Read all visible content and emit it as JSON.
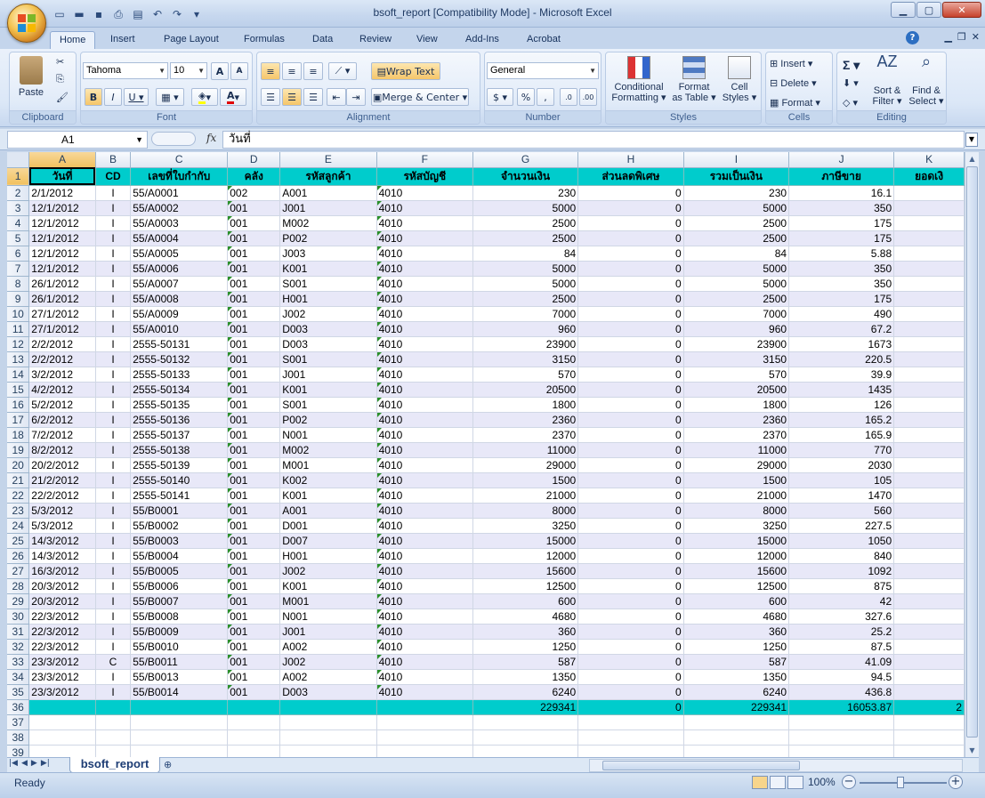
{
  "window": {
    "title": "bsoft_report  [Compatibility Mode] - Microsoft Excel"
  },
  "ribbon_tabs": [
    "Home",
    "Insert",
    "Page Layout",
    "Formulas",
    "Data",
    "Review",
    "View",
    "Add-Ins",
    "Acrobat"
  ],
  "ribbon": {
    "clipboard": {
      "label": "Clipboard",
      "paste": "Paste"
    },
    "font": {
      "label": "Font",
      "name": "Tahoma",
      "size": "10"
    },
    "alignment": {
      "label": "Alignment",
      "wrap_text": "Wrap Text",
      "merge_center": "Merge & Center"
    },
    "number": {
      "label": "Number",
      "format": "General"
    },
    "styles": {
      "label": "Styles",
      "conditional_1": "Conditional",
      "conditional_2": "Formatting",
      "format_table_1": "Format",
      "format_table_2": "as Table",
      "cell_styles_1": "Cell",
      "cell_styles_2": "Styles"
    },
    "cells": {
      "label": "Cells",
      "insert": "Insert",
      "delete": "Delete",
      "format": "Format"
    },
    "editing": {
      "label": "Editing",
      "sort_1": "Sort &",
      "sort_2": "Filter",
      "find_1": "Find &",
      "find_2": "Select"
    }
  },
  "formula_bar": {
    "name_box": "A1",
    "fx": "fx",
    "content": "วันที่"
  },
  "columns": [
    "A",
    "B",
    "C",
    "D",
    "E",
    "F",
    "G",
    "H",
    "I",
    "J",
    "K"
  ],
  "headers": [
    "วันที่",
    "CD",
    "เลขที่ใบกำกับ",
    "คลัง",
    "รหัสลูกค้า",
    "รหัสบัญชี",
    "จำนวนเงิน",
    "ส่วนลดพิเศษ",
    "รวมเป็นเงิน",
    "ภาษีขาย",
    "ยอดเงิ"
  ],
  "rows": [
    [
      "2/1/2012",
      "I",
      "55/A0001",
      "002",
      "A001",
      "4010",
      "230",
      "0",
      "230",
      "16.1"
    ],
    [
      "12/1/2012",
      "I",
      "55/A0002",
      "001",
      "J001",
      "4010",
      "5000",
      "0",
      "5000",
      "350"
    ],
    [
      "12/1/2012",
      "I",
      "55/A0003",
      "001",
      "M002",
      "4010",
      "2500",
      "0",
      "2500",
      "175"
    ],
    [
      "12/1/2012",
      "I",
      "55/A0004",
      "001",
      "P002",
      "4010",
      "2500",
      "0",
      "2500",
      "175"
    ],
    [
      "12/1/2012",
      "I",
      "55/A0005",
      "001",
      "J003",
      "4010",
      "84",
      "0",
      "84",
      "5.88"
    ],
    [
      "12/1/2012",
      "I",
      "55/A0006",
      "001",
      "K001",
      "4010",
      "5000",
      "0",
      "5000",
      "350"
    ],
    [
      "26/1/2012",
      "I",
      "55/A0007",
      "001",
      "S001",
      "4010",
      "5000",
      "0",
      "5000",
      "350"
    ],
    [
      "26/1/2012",
      "I",
      "55/A0008",
      "001",
      "H001",
      "4010",
      "2500",
      "0",
      "2500",
      "175"
    ],
    [
      "27/1/2012",
      "I",
      "55/A0009",
      "001",
      "J002",
      "4010",
      "7000",
      "0",
      "7000",
      "490"
    ],
    [
      "27/1/2012",
      "I",
      "55/A0010",
      "001",
      "D003",
      "4010",
      "960",
      "0",
      "960",
      "67.2"
    ],
    [
      "2/2/2012",
      "I",
      "2555-50131",
      "001",
      "D003",
      "4010",
      "23900",
      "0",
      "23900",
      "1673"
    ],
    [
      "2/2/2012",
      "I",
      "2555-50132",
      "001",
      "S001",
      "4010",
      "3150",
      "0",
      "3150",
      "220.5"
    ],
    [
      "3/2/2012",
      "I",
      "2555-50133",
      "001",
      "J001",
      "4010",
      "570",
      "0",
      "570",
      "39.9"
    ],
    [
      "4/2/2012",
      "I",
      "2555-50134",
      "001",
      "K001",
      "4010",
      "20500",
      "0",
      "20500",
      "1435"
    ],
    [
      "5/2/2012",
      "I",
      "2555-50135",
      "001",
      "S001",
      "4010",
      "1800",
      "0",
      "1800",
      "126"
    ],
    [
      "6/2/2012",
      "I",
      "2555-50136",
      "001",
      "P002",
      "4010",
      "2360",
      "0",
      "2360",
      "165.2"
    ],
    [
      "7/2/2012",
      "I",
      "2555-50137",
      "001",
      "N001",
      "4010",
      "2370",
      "0",
      "2370",
      "165.9"
    ],
    [
      "8/2/2012",
      "I",
      "2555-50138",
      "001",
      "M002",
      "4010",
      "11000",
      "0",
      "11000",
      "770"
    ],
    [
      "20/2/2012",
      "I",
      "2555-50139",
      "001",
      "M001",
      "4010",
      "29000",
      "0",
      "29000",
      "2030"
    ],
    [
      "21/2/2012",
      "I",
      "2555-50140",
      "001",
      "K002",
      "4010",
      "1500",
      "0",
      "1500",
      "105"
    ],
    [
      "22/2/2012",
      "I",
      "2555-50141",
      "001",
      "K001",
      "4010",
      "21000",
      "0",
      "21000",
      "1470"
    ],
    [
      "5/3/2012",
      "I",
      "55/B0001",
      "001",
      "A001",
      "4010",
      "8000",
      "0",
      "8000",
      "560"
    ],
    [
      "5/3/2012",
      "I",
      "55/B0002",
      "001",
      "D001",
      "4010",
      "3250",
      "0",
      "3250",
      "227.5"
    ],
    [
      "14/3/2012",
      "I",
      "55/B0003",
      "001",
      "D007",
      "4010",
      "15000",
      "0",
      "15000",
      "1050"
    ],
    [
      "14/3/2012",
      "I",
      "55/B0004",
      "001",
      "H001",
      "4010",
      "12000",
      "0",
      "12000",
      "840"
    ],
    [
      "16/3/2012",
      "I",
      "55/B0005",
      "001",
      "J002",
      "4010",
      "15600",
      "0",
      "15600",
      "1092"
    ],
    [
      "20/3/2012",
      "I",
      "55/B0006",
      "001",
      "K001",
      "4010",
      "12500",
      "0",
      "12500",
      "875"
    ],
    [
      "20/3/2012",
      "I",
      "55/B0007",
      "001",
      "M001",
      "4010",
      "600",
      "0",
      "600",
      "42"
    ],
    [
      "22/3/2012",
      "I",
      "55/B0008",
      "001",
      "N001",
      "4010",
      "4680",
      "0",
      "4680",
      "327.6"
    ],
    [
      "22/3/2012",
      "I",
      "55/B0009",
      "001",
      "J001",
      "4010",
      "360",
      "0",
      "360",
      "25.2"
    ],
    [
      "22/3/2012",
      "I",
      "55/B0010",
      "001",
      "A002",
      "4010",
      "1250",
      "0",
      "1250",
      "87.5"
    ],
    [
      "23/3/2012",
      "C",
      "55/B0011",
      "001",
      "J002",
      "4010",
      "587",
      "0",
      "587",
      "41.09"
    ],
    [
      "23/3/2012",
      "I",
      "55/B0013",
      "001",
      "A002",
      "4010",
      "1350",
      "0",
      "1350",
      "94.5"
    ],
    [
      "23/3/2012",
      "I",
      "55/B0014",
      "001",
      "D003",
      "4010",
      "6240",
      "0",
      "6240",
      "436.8"
    ]
  ],
  "totals": [
    "",
    "",
    "",
    "",
    "",
    "",
    "229341",
    "0",
    "229341",
    "16053.87",
    "2"
  ],
  "extra_row_numbers": [
    "37",
    "38",
    "39"
  ],
  "sheet_tab": "bsoft_report",
  "status": {
    "ready": "Ready",
    "zoom": "100%"
  },
  "colors": {
    "header_fill": "#00cccc",
    "band_fill": "#e8e8f8",
    "selection": "#f1c15f"
  }
}
